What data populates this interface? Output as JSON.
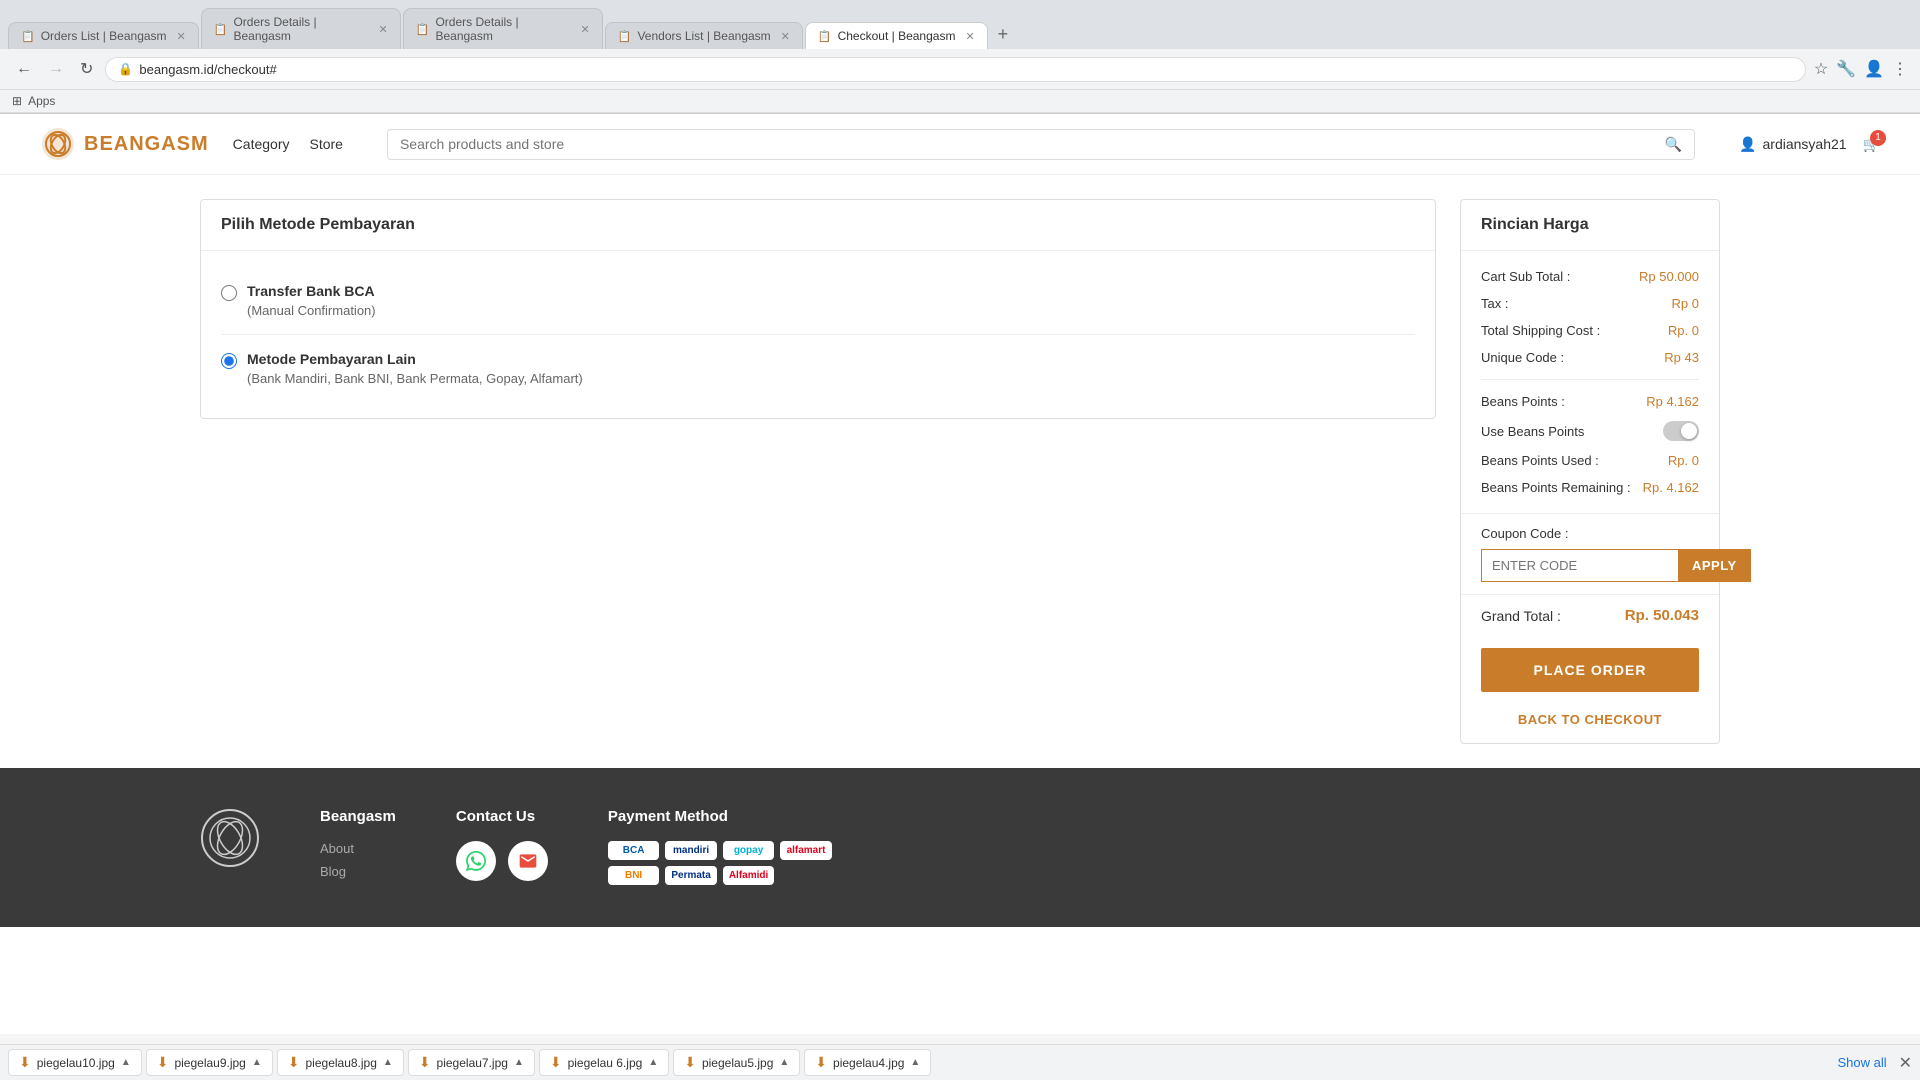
{
  "browser": {
    "tabs": [
      {
        "label": "Orders List | Beangasm",
        "active": false,
        "icon": "📋"
      },
      {
        "label": "Orders Details | Beangasm",
        "active": false,
        "icon": "📋"
      },
      {
        "label": "Orders Details | Beangasm",
        "active": false,
        "icon": "📋"
      },
      {
        "label": "Vendors List | Beangasm",
        "active": false,
        "icon": "📋"
      },
      {
        "label": "Checkout | Beangasm",
        "active": true,
        "icon": "📋"
      }
    ],
    "url": "beangasm.id/checkout#",
    "apps_label": "Apps"
  },
  "header": {
    "logo_text": "BEANGASM",
    "nav_items": [
      "Category",
      "Store"
    ],
    "search_placeholder": "Search products and store",
    "user_name": "ardiansyah21",
    "cart_count": "1"
  },
  "payment_section": {
    "title": "Pilih Metode Pembayaran",
    "options": [
      {
        "name": "Transfer Bank BCA",
        "desc": "(Manual Confirmation)",
        "selected": false
      },
      {
        "name": "Metode Pembayaran Lain",
        "desc": "(Bank Mandiri, Bank BNI, Bank Permata, Gopay, Alfamart)",
        "selected": true
      }
    ]
  },
  "price_section": {
    "title": "Rincian Harga",
    "cart_sub_total_label": "Cart Sub Total :",
    "cart_sub_total_value": "Rp 50.000",
    "tax_label": "Tax :",
    "tax_value": "Rp 0",
    "shipping_label": "Total Shipping Cost :",
    "shipping_value": "Rp. 0",
    "unique_code_label": "Unique Code :",
    "unique_code_value": "Rp 43",
    "beans_points_label": "Beans Points :",
    "beans_points_value": "Rp 4.162",
    "use_beans_label": "Use Beans Points",
    "beans_used_label": "Beans Points Used :",
    "beans_used_value": "Rp. 0",
    "beans_remaining_label": "Beans Points Remaining :",
    "beans_remaining_value": "Rp. 4.162",
    "coupon_label": "Coupon Code :",
    "coupon_placeholder": "ENTER CODE",
    "apply_btn": "APPLY",
    "grand_total_label": "Grand Total :",
    "grand_total_value": "Rp. 50.043",
    "place_order_btn": "PLACE ORDER",
    "back_to_checkout": "BACK TO CHECKOUT"
  },
  "footer": {
    "beangasm_col": {
      "title": "Beangasm",
      "links": [
        "About",
        "Blog"
      ]
    },
    "contact_col": {
      "title": "Contact Us"
    },
    "payment_col": {
      "title": "Payment Method",
      "methods": [
        {
          "name": "BCA",
          "class": "bca-logo"
        },
        {
          "name": "Mandiri",
          "class": "mandiri-logo"
        },
        {
          "name": "Gopay",
          "class": "gopay-logo"
        },
        {
          "name": "Alfamart",
          "class": "alfamart-logo"
        },
        {
          "name": "BNI",
          "class": "bni-logo"
        },
        {
          "name": "Permata",
          "class": "permata-logo"
        },
        {
          "name": "Alfamidi",
          "class": "alfamidi-logo"
        }
      ]
    }
  },
  "download_bar": {
    "items": [
      "piegelau10.jpg",
      "piegelau9.jpg",
      "piegelau8.jpg",
      "piegelau7.jpg",
      "piegelau 6.jpg",
      "piegelau5.jpg",
      "piegelau4.jpg"
    ],
    "show_all": "Show all"
  }
}
